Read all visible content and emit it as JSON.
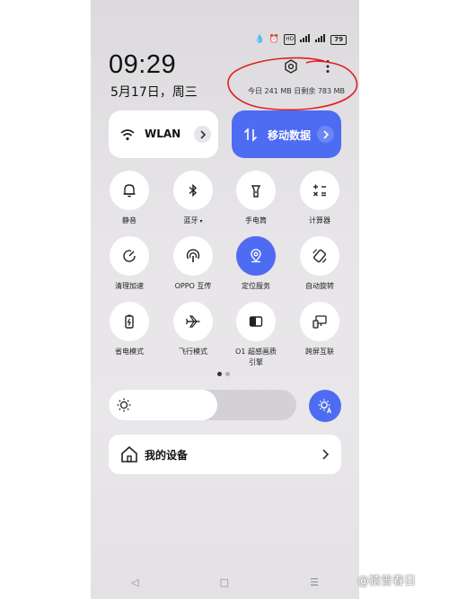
{
  "status_bar": {
    "icons": [
      "drop-icon",
      "alarm-icon",
      "hd-icon",
      "signal-5g-icon",
      "signal-icon"
    ],
    "hd_label": "HD",
    "battery": "79"
  },
  "header": {
    "time": "09:29",
    "date": "5月17日，周三",
    "memory_info": "今日 241 MB 日剩余 783 MB",
    "annotation_color": "#e02020"
  },
  "top_cards": {
    "wlan_label": "WLAN",
    "mobile_data_label": "移动数据"
  },
  "tiles": [
    {
      "label": "静音",
      "icon": "bell-icon",
      "active": false
    },
    {
      "label": "蓝牙",
      "icon": "bluetooth-icon",
      "active": false,
      "has_menu": true
    },
    {
      "label": "手电筒",
      "icon": "flashlight-icon",
      "active": false
    },
    {
      "label": "计算器",
      "icon": "calculator-icon",
      "active": false
    },
    {
      "label": "清理加速",
      "icon": "cleanup-icon",
      "active": false
    },
    {
      "label": "OPPO 互传",
      "icon": "share-icon",
      "active": false
    },
    {
      "label": "定位服务",
      "icon": "location-icon",
      "active": true
    },
    {
      "label": "自动旋转",
      "icon": "rotate-icon",
      "active": false
    },
    {
      "label": "省电模式",
      "icon": "battery-saver-icon",
      "active": false
    },
    {
      "label": "飞行模式",
      "icon": "airplane-icon",
      "active": false
    },
    {
      "label": "O1 超感画质\n引擎",
      "icon": "display-engine-icon",
      "active": false
    },
    {
      "label": "跨屏互联",
      "icon": "screen-connect-icon",
      "active": false
    }
  ],
  "pager": {
    "pages": 2,
    "current": 1
  },
  "brightness": {
    "level": 0.58
  },
  "device": {
    "label": "我的设备"
  },
  "watermark": "@猿曾春日",
  "colors": {
    "accent": "#4d6cf2",
    "tile_bg": "#ffffff"
  }
}
